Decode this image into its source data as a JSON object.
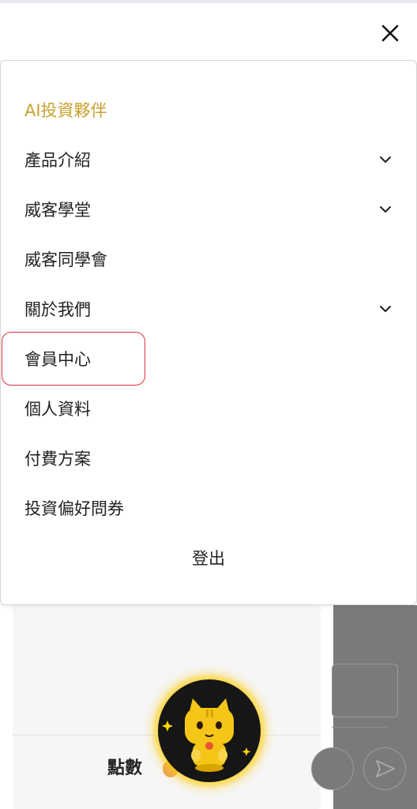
{
  "menu": {
    "brand": "AI投資夥伴",
    "items": [
      {
        "label": "產品介紹",
        "expandable": true
      },
      {
        "label": "威客學堂",
        "expandable": true
      },
      {
        "label": "威客同學會",
        "expandable": false
      },
      {
        "label": "關於我們",
        "expandable": true
      },
      {
        "label": "會員中心",
        "expandable": false,
        "highlighted": true
      },
      {
        "label": "個人資料",
        "expandable": false
      },
      {
        "label": "付費方案",
        "expandable": false
      },
      {
        "label": "投資偏好問券",
        "expandable": false
      }
    ],
    "logout": "登出"
  },
  "background": {
    "points_label": "點數"
  },
  "icons": {
    "close": "close-icon",
    "chevron": "chevron-down-icon",
    "send": "send-icon",
    "mascot": "cat-mascot-icon"
  },
  "colors": {
    "brand": "#c9a12f",
    "highlight_border": "#d9313f",
    "mascot_glow": "#ffd60a"
  }
}
